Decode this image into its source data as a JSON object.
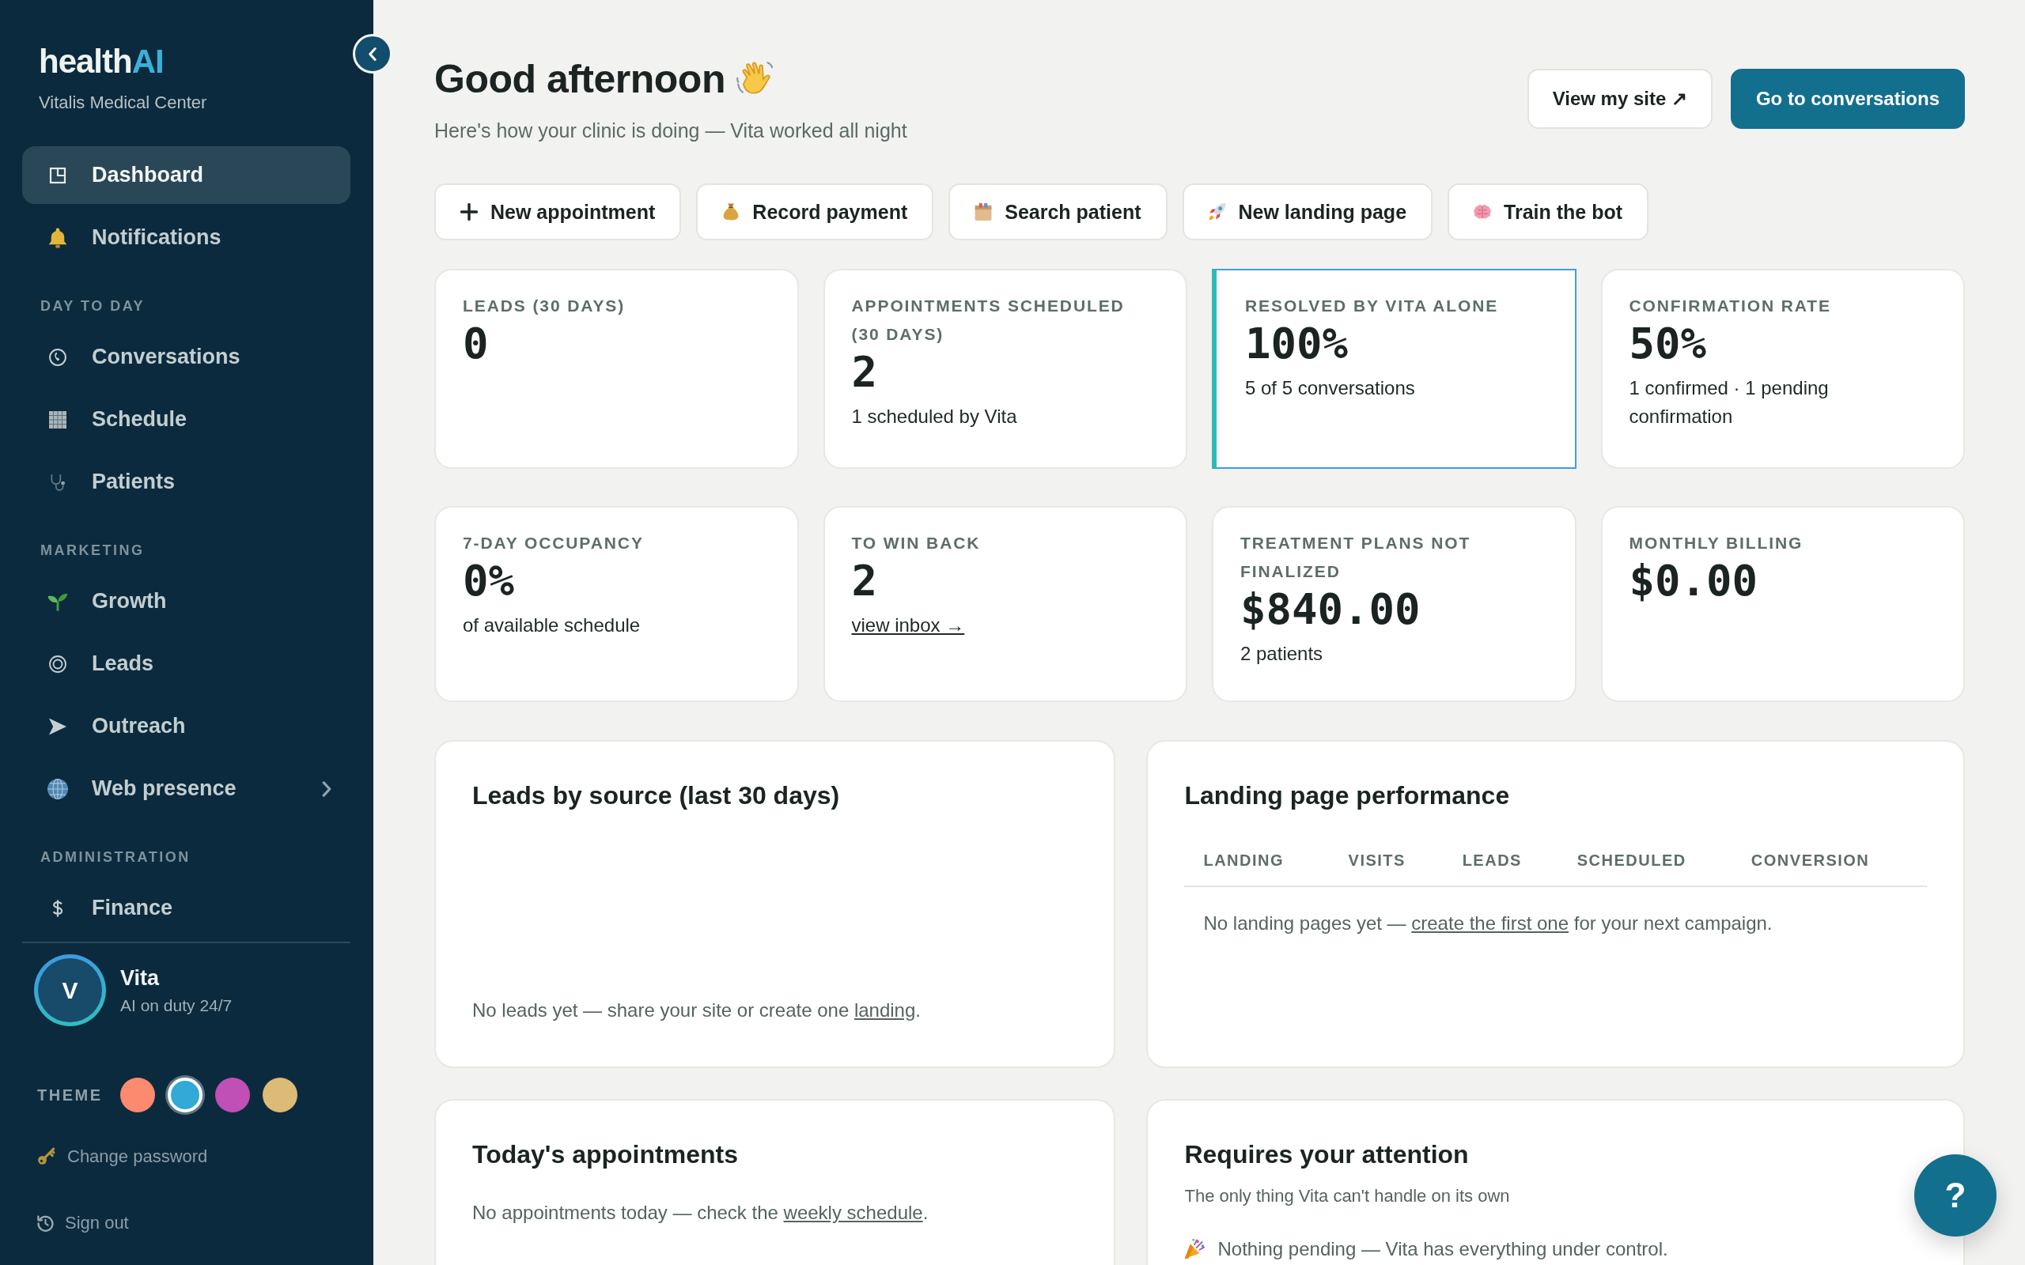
{
  "sidebar": {
    "logo": {
      "text": "health",
      "accent": "AI"
    },
    "clinic": "Vitalis Medical Center",
    "nav": [
      {
        "items": [
          {
            "label": "Dashboard",
            "kind": "link",
            "selected": true
          },
          {
            "label": "Notifications",
            "kind": "link",
            "selected": false
          }
        ]
      },
      {
        "heading": "DAY TO DAY",
        "items": [
          {
            "label": "Conversations",
            "kind": "link",
            "selected": false
          },
          {
            "label": "Schedule",
            "kind": "link",
            "selected": false
          },
          {
            "label": "Patients",
            "kind": "link",
            "selected": false
          }
        ]
      },
      {
        "heading": "MARKETING",
        "items": [
          {
            "label": "Growth",
            "kind": "link",
            "selected": false
          },
          {
            "label": "Leads",
            "kind": "link",
            "selected": false
          },
          {
            "label": "Outreach",
            "kind": "link",
            "selected": false
          },
          {
            "label": "Web presence",
            "kind": "submenu",
            "selected": false
          }
        ]
      },
      {
        "heading": "ADMINISTRATION",
        "items": [
          {
            "label": "Finance",
            "kind": "link",
            "selected": false
          }
        ]
      }
    ],
    "assistant": {
      "initial": "V",
      "name": "Vita",
      "status": "AI on duty 24/7"
    },
    "theme": {
      "label": "THEME",
      "swatches": [
        {
          "color": "#fb8a6e",
          "selected": false
        },
        {
          "color": "#33a9d8",
          "selected": true
        },
        {
          "color": "#c04fb6",
          "selected": false
        },
        {
          "color": "#dbbb76",
          "selected": false
        }
      ]
    },
    "links": [
      {
        "label": "Change password"
      },
      {
        "label": "Sign out"
      }
    ]
  },
  "header": {
    "title": "Good afternoon",
    "subtitle": "Here's how your clinic is doing — Vita worked all night",
    "buttons": [
      {
        "label": "View my site ↗",
        "kind": "secondary"
      },
      {
        "label": "Go to conversations",
        "kind": "primary"
      }
    ]
  },
  "quick_actions": [
    {
      "label": "New appointment"
    },
    {
      "label": "Record payment"
    },
    {
      "label": "Search patient"
    },
    {
      "label": "New landing page"
    },
    {
      "label": "Train the bot"
    }
  ],
  "stats": [
    {
      "label": "LEADS (30 DAYS)",
      "value": "0",
      "highlighted": false
    },
    {
      "label": "APPOINTMENTS SCHEDULED (30 DAYS)",
      "value": "2",
      "note": "1 scheduled by Vita",
      "highlighted": false
    },
    {
      "label": "RESOLVED BY VITA ALONE",
      "value": "100%",
      "note": "5 of 5 conversations",
      "highlighted": true
    },
    {
      "label": "CONFIRMATION RATE",
      "value": "50%",
      "note": "1 confirmed · 1 pending confirmation",
      "highlighted": false
    },
    {
      "label": "7-DAY OCCUPANCY",
      "value": "0%",
      "note": "of available schedule",
      "highlighted": false
    },
    {
      "label": "TO WIN BACK",
      "value": "2",
      "link": "view inbox →",
      "highlighted": false
    },
    {
      "label": "TREATMENT PLANS NOT FINALIZED",
      "value": "$840.00",
      "note": "2 patients",
      "highlighted": false
    },
    {
      "label": "MONTHLY BILLING",
      "value": "$0.00",
      "highlighted": false
    }
  ],
  "leads_by_source": {
    "title": "Leads by source (last 30 days)",
    "message": {
      "before": "No leads yet — share your site or create one ",
      "link": "landing",
      "after": "."
    }
  },
  "landing_performance": {
    "title": "Landing page performance",
    "columns": [
      "LANDING",
      "VISITS",
      "LEADS",
      "SCHEDULED",
      "CONVERSION"
    ],
    "message": {
      "before": "No landing pages yet — ",
      "link": "create the first one",
      "after": " for your next campaign."
    }
  },
  "todays_appointments": {
    "title": "Today's appointments",
    "message": {
      "before": "No appointments today — check the ",
      "link": "weekly schedule",
      "after": "."
    }
  },
  "attention": {
    "title": "Requires your attention",
    "subtitle": "The only thing Vita can't handle on its own",
    "message": "Nothing pending — Vita has everything under control."
  },
  "help": {
    "label": "?"
  }
}
